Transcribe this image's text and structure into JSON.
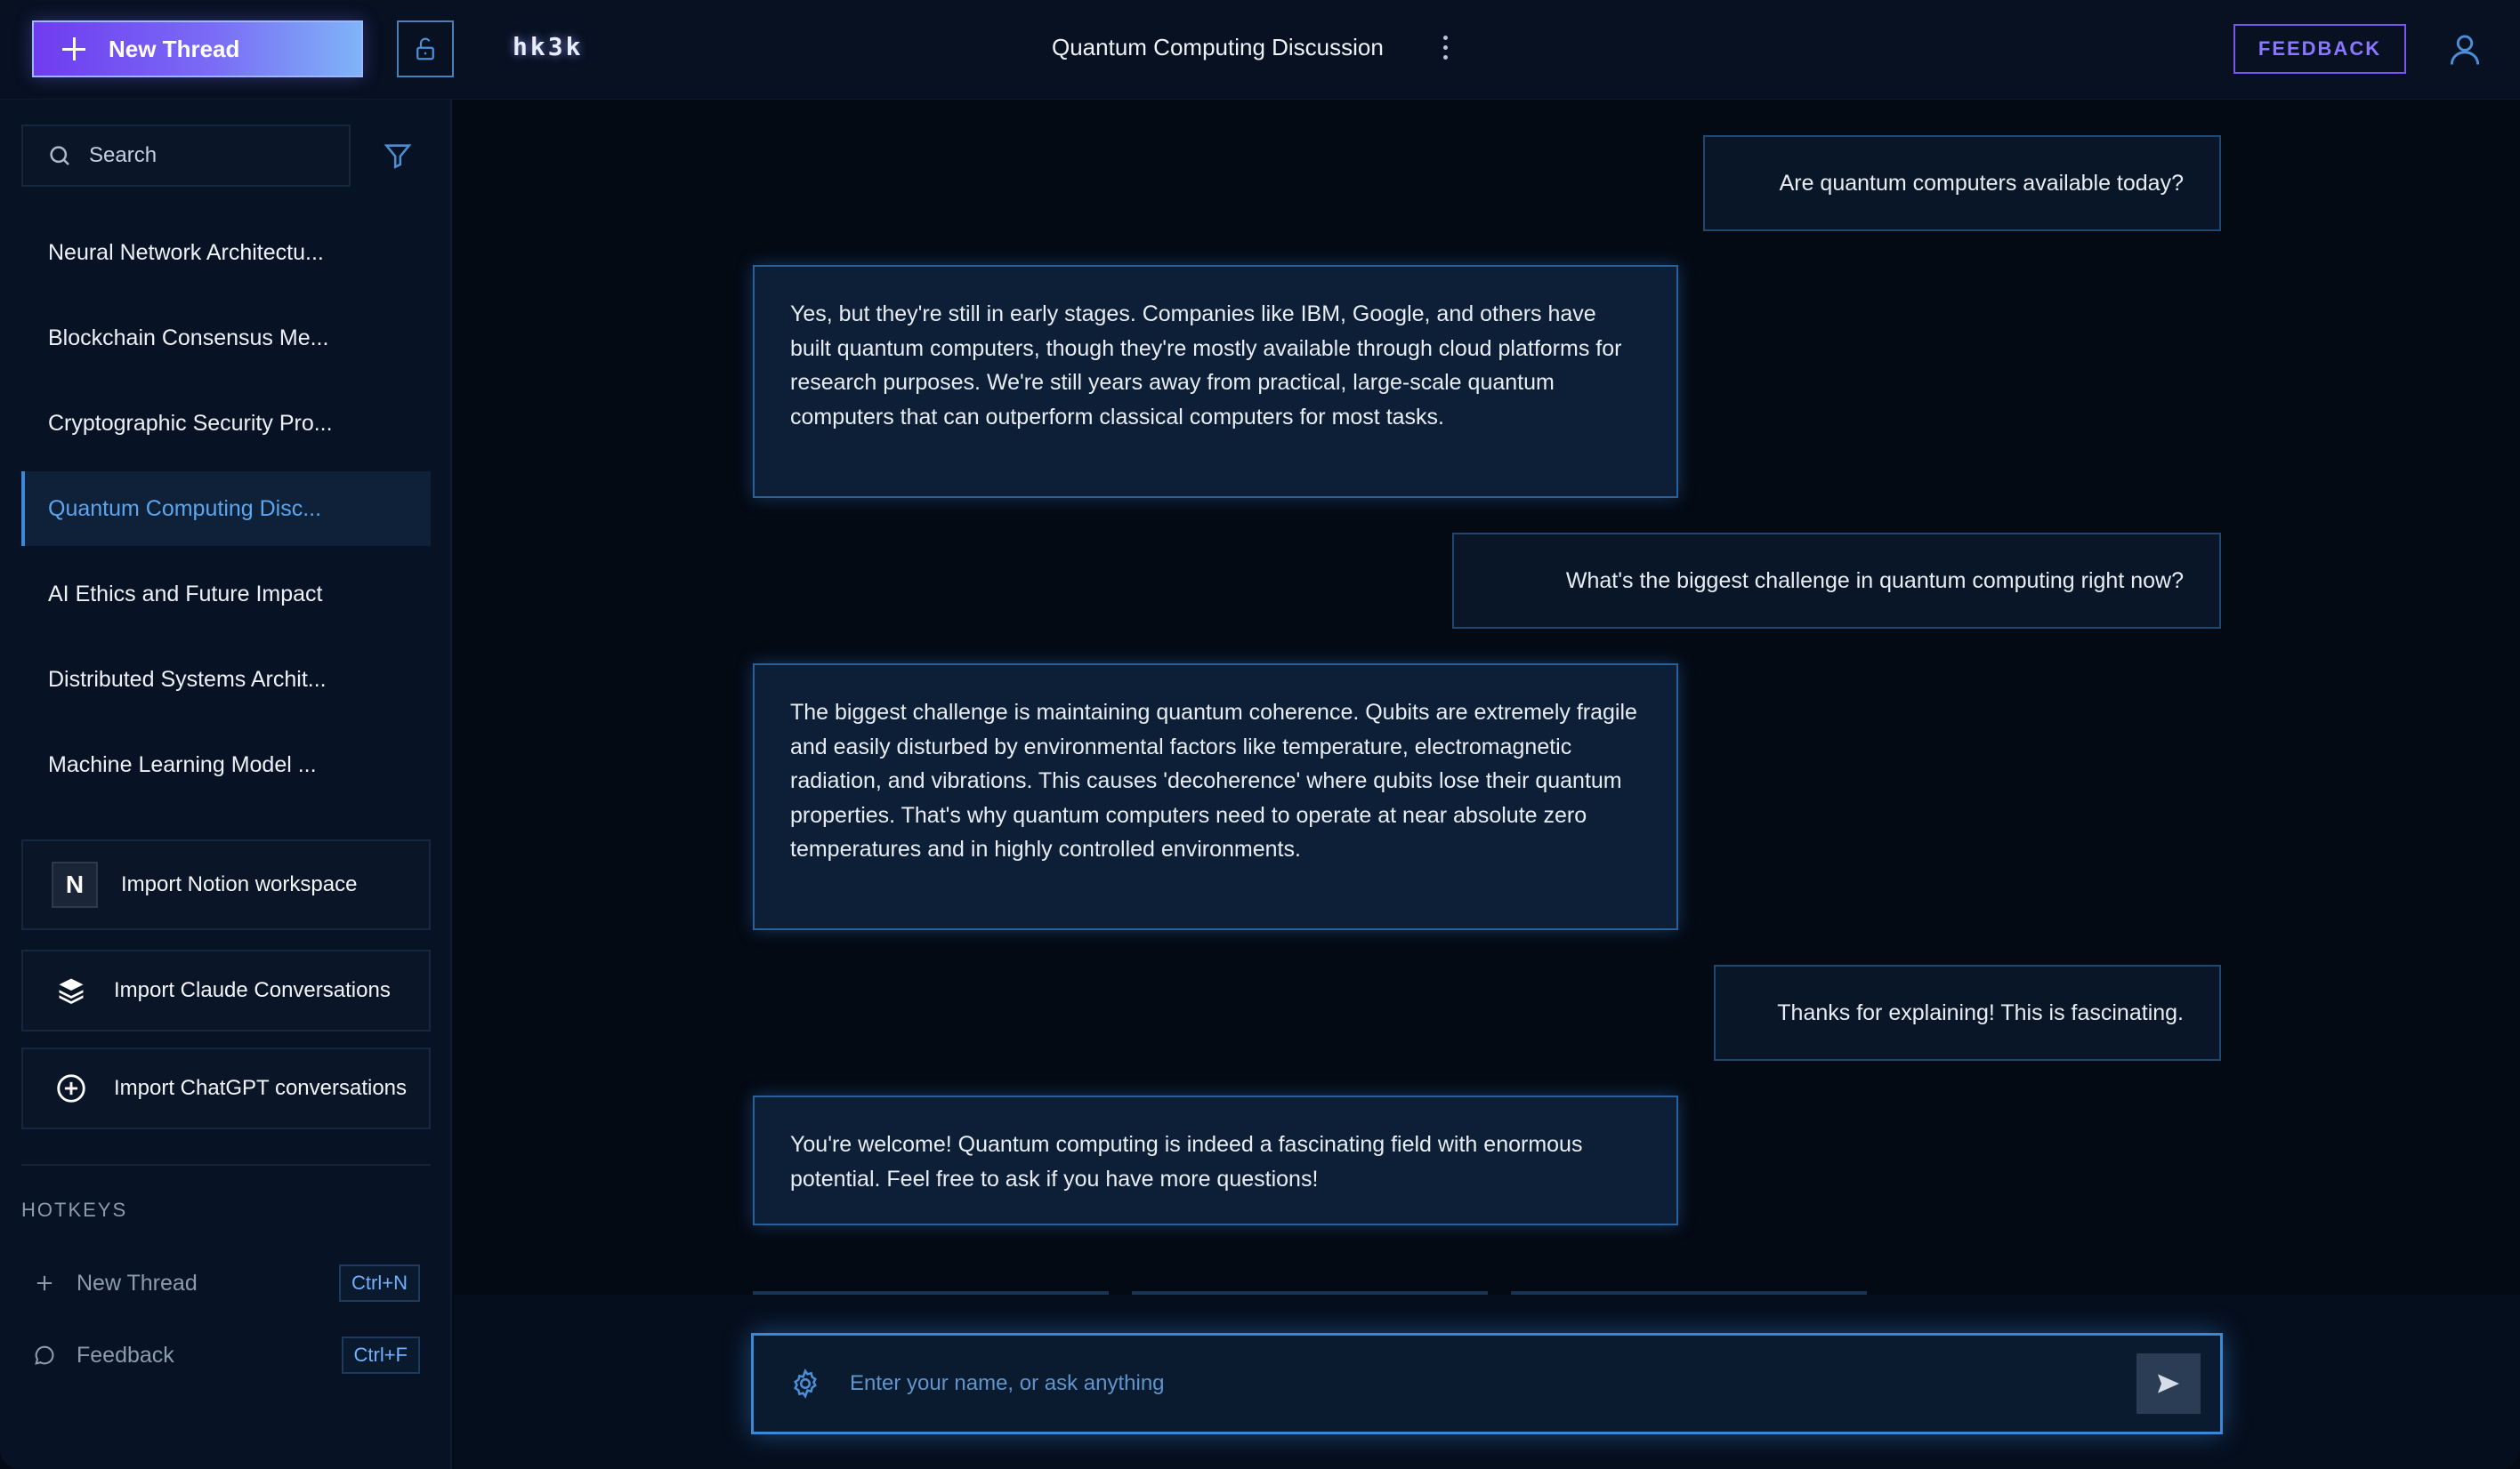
{
  "header": {
    "new_thread_label": "New Thread",
    "brand": "hk3k",
    "thread_title": "Quantum Computing Discussion",
    "feedback_label": "FEEDBACK"
  },
  "sidebar": {
    "search_placeholder": "Search",
    "threads": [
      {
        "label": "Neural Network Architectu...",
        "active": false
      },
      {
        "label": "Blockchain Consensus Me...",
        "active": false
      },
      {
        "label": "Cryptographic Security Pro...",
        "active": false
      },
      {
        "label": "Quantum Computing Disc...",
        "active": true
      },
      {
        "label": "AI Ethics and Future Impact",
        "active": false
      },
      {
        "label": "Distributed Systems Archit...",
        "active": false
      },
      {
        "label": "Machine Learning Model ...",
        "active": false
      }
    ],
    "imports": {
      "notion": {
        "label": "Import Notion workspace",
        "icon_letter": "N"
      },
      "claude": {
        "label": "Import Claude Conversations"
      },
      "chatgpt": {
        "label": "Import ChatGPT conversations"
      }
    },
    "hotkeys_title": "HOTKEYS",
    "hotkeys": [
      {
        "label": "New Thread",
        "key": "Ctrl+N"
      },
      {
        "label": "Feedback",
        "key": "Ctrl+F"
      }
    ]
  },
  "messages": [
    {
      "role": "user",
      "text": "Are quantum computers available today?"
    },
    {
      "role": "assistant",
      "text": "Yes, but they're still in early stages. Companies like IBM, Google, and others have built quantum computers, though they're mostly available through cloud platforms for research purposes. We're still years away from practical, large-scale quantum computers that can outperform classical computers for most tasks."
    },
    {
      "role": "user",
      "text": "What's the biggest challenge in quantum computing right now?"
    },
    {
      "role": "assistant",
      "text": "The biggest challenge is maintaining quantum coherence. Qubits are extremely fragile and easily disturbed by environmental factors like temperature, electromagnetic radiation, and vibrations. This causes 'decoherence' where qubits lose their quantum properties. That's why quantum computers need to operate at near absolute zero temperatures and in highly controlled environments."
    },
    {
      "role": "user",
      "text": "Thanks for explaining! This is fascinating."
    },
    {
      "role": "assistant",
      "text": "You're welcome! Quantum computing is indeed a fascinating field with enormous potential. Feel free to ask if you have more questions!"
    }
  ],
  "composer": {
    "placeholder": "Enter your name, or ask anything"
  },
  "colors": {
    "accent": "#3d86d8",
    "brand_purple": "#7657e8",
    "background": "#050b16"
  }
}
